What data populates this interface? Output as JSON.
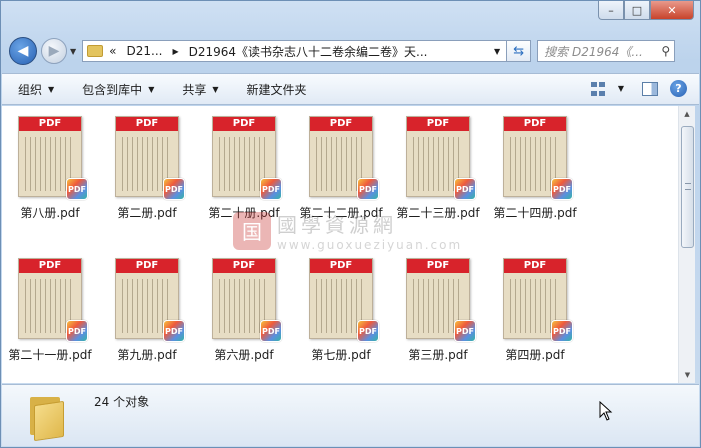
{
  "window": {
    "controls": {
      "minimize": "–",
      "maximize": "□",
      "close": "✕"
    }
  },
  "nav": {
    "address_segments": [
      "«",
      "D21...",
      "D21964《读书杂志八十二卷余编二卷》天..."
    ],
    "search_placeholder": "搜索 D21964《..."
  },
  "toolbar": {
    "items": [
      {
        "label": "组织",
        "has_dropdown": true
      },
      {
        "label": "包含到库中",
        "has_dropdown": true
      },
      {
        "label": "共享",
        "has_dropdown": true
      },
      {
        "label": "新建文件夹",
        "has_dropdown": false
      }
    ]
  },
  "files": [
    {
      "name": "第八册.pdf",
      "banner": "PDF",
      "badge": "PDF"
    },
    {
      "name": "第二册.pdf",
      "banner": "PDF",
      "badge": "PDF"
    },
    {
      "name": "第二十册.pdf",
      "banner": "PDF",
      "badge": "PDF"
    },
    {
      "name": "第二十二册.pdf",
      "banner": "PDF",
      "badge": "PDF"
    },
    {
      "name": "第二十三册.pdf",
      "banner": "PDF",
      "badge": "PDF"
    },
    {
      "name": "第二十四册.pdf",
      "banner": "PDF",
      "badge": "PDF"
    },
    {
      "name": "第二十一册.pdf",
      "banner": "PDF",
      "badge": "PDF"
    },
    {
      "name": "第九册.pdf",
      "banner": "PDF",
      "badge": "PDF"
    },
    {
      "name": "第六册.pdf",
      "banner": "PDF",
      "badge": "PDF"
    },
    {
      "name": "第七册.pdf",
      "banner": "PDF",
      "badge": "PDF"
    },
    {
      "name": "第三册.pdf",
      "banner": "PDF",
      "badge": "PDF"
    },
    {
      "name": "第四册.pdf",
      "banner": "PDF",
      "badge": "PDF"
    }
  ],
  "watermark": {
    "logo": "国",
    "text": "國學資源網",
    "url": "www.guoxueziyuan.com"
  },
  "status": {
    "count_text": "24 个对象"
  },
  "colors": {
    "pdf_banner": "#d8232b",
    "accent": "#2861b3"
  }
}
